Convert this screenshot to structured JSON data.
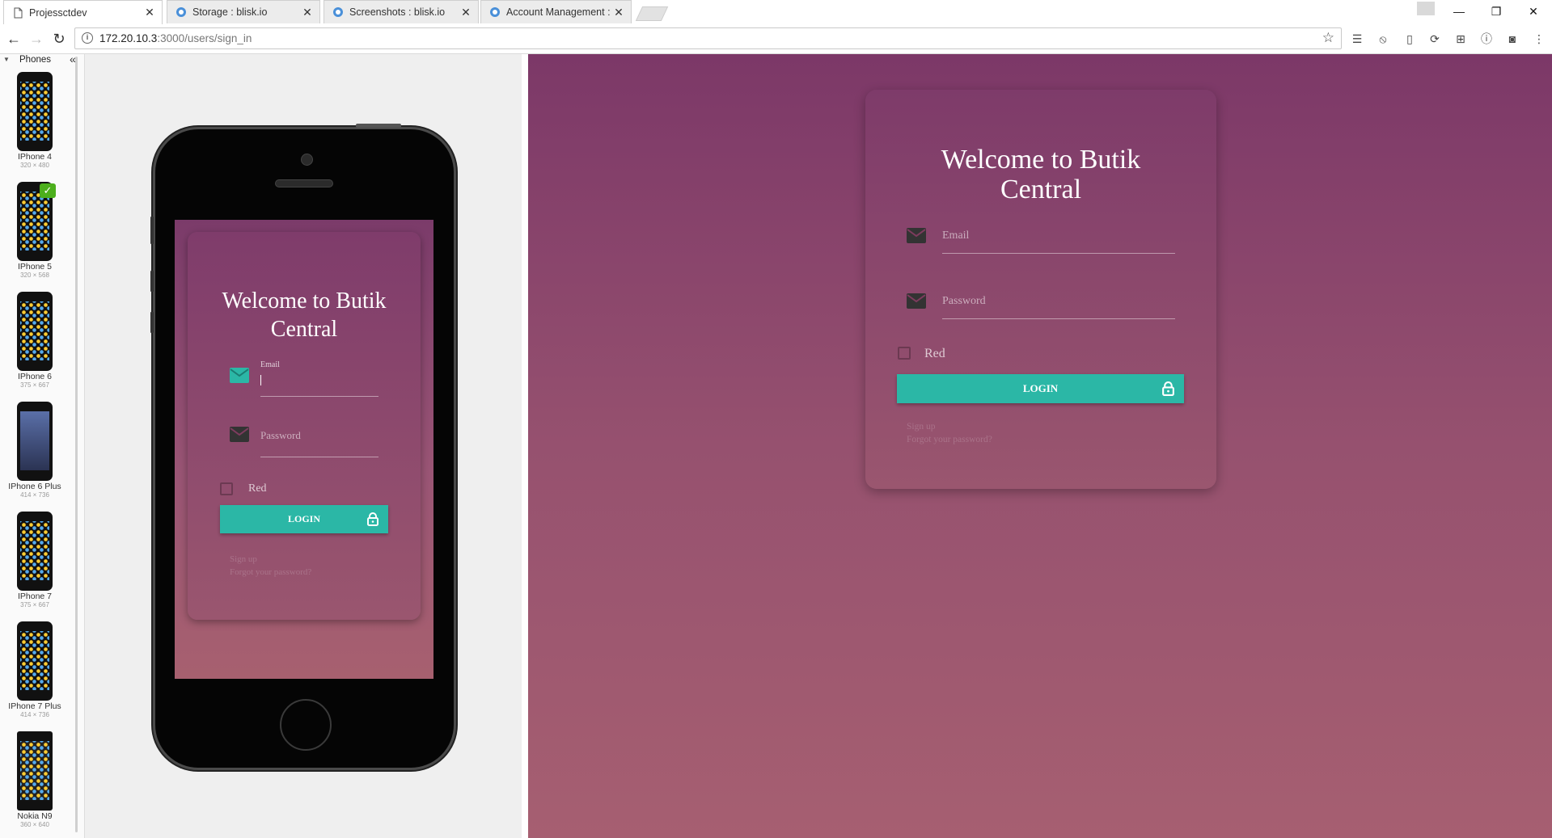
{
  "browser": {
    "tabs": [
      {
        "title": "Projessctdev",
        "active": true
      },
      {
        "title": "Storage : blisk.io",
        "active": false
      },
      {
        "title": "Screenshots : blisk.io",
        "active": false
      },
      {
        "title": "Account Management : b",
        "active": false
      }
    ],
    "url_host": "172.20.10.3",
    "url_path": ":3000/users/sign_in"
  },
  "devices": {
    "header": "Phones",
    "items": [
      {
        "name": "IPhone 4",
        "size": "320 × 480",
        "selected": false
      },
      {
        "name": "IPhone 5",
        "size": "320 × 568",
        "selected": true
      },
      {
        "name": "IPhone 6",
        "size": "375 × 667",
        "selected": false
      },
      {
        "name": "IPhone 6 Plus",
        "size": "414 × 736",
        "selected": false
      },
      {
        "name": "IPhone 7",
        "size": "375 × 667",
        "selected": false
      },
      {
        "name": "IPhone 7 Plus",
        "size": "414 × 736",
        "selected": false
      },
      {
        "name": "Nokia N9",
        "size": "360 × 640",
        "selected": false
      }
    ]
  },
  "login": {
    "title_mobile": "Welcome to Butik Central",
    "title_desktop": "Welcome to Butik Central",
    "email_label": "Email",
    "email_placeholder": "Email",
    "password_placeholder": "Password",
    "remember_label": "Red",
    "login_button": "LOGIN",
    "signup_link": "Sign up",
    "forgot_link": "Forgot your password?"
  },
  "colors": {
    "accent": "#2bb7a6",
    "gradient_top": "#7c3868",
    "gradient_bottom": "#a65f71"
  }
}
